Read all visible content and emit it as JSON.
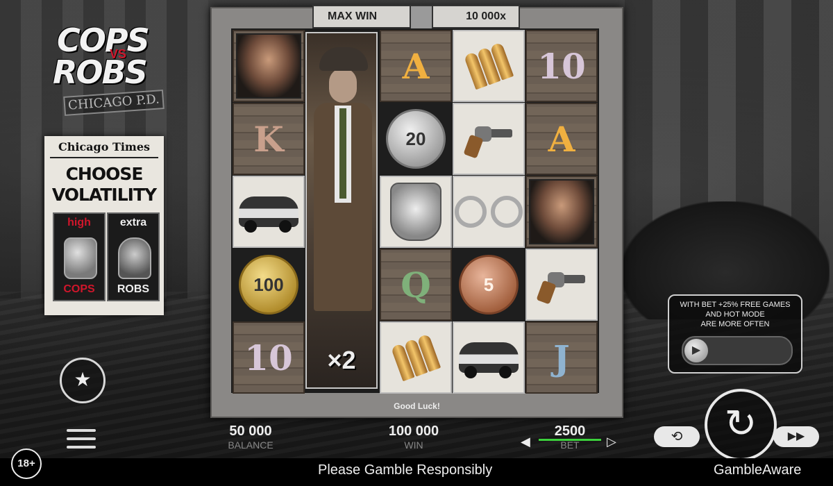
{
  "logo": {
    "cops": "COPS",
    "vs": "VS",
    "robs": "ROBS",
    "subtitle": "CHICAGO P.D."
  },
  "newspaper": {
    "title": "Chicago Times",
    "headline_line1": "CHOOSE",
    "headline_line2": "VOLATILITY",
    "options": [
      {
        "top": "high",
        "bottom": "COPS",
        "color": "#d0162b",
        "icon": "police-badge-icon"
      },
      {
        "top": "extra",
        "bottom": "ROBS",
        "color": "#f0f0f0",
        "icon": "ring-icon"
      }
    ]
  },
  "maxwin": {
    "label": "MAX WIN",
    "value": "10 000x",
    "icon": "safe-icon"
  },
  "reels": {
    "columns": [
      [
        "portrait-robber",
        "K",
        "police-car",
        "coin-100",
        "10"
      ],
      [
        "detective-wild",
        "",
        "",
        "",
        ""
      ],
      [
        "A",
        "coin-20",
        "police-badge",
        "Q",
        "bullets"
      ],
      [
        "bullets",
        "revolver",
        "handcuffs",
        "coin-5",
        "police-car"
      ],
      [
        "10",
        "A",
        "portrait-robber",
        "revolver",
        "J"
      ]
    ],
    "letters": {
      "K": "K",
      "A": "A",
      "Q": "Q",
      "J": "J",
      "ten": "10"
    },
    "coins": {
      "c20": "20",
      "c100": "100",
      "c5": "5"
    },
    "multiplier": "×2"
  },
  "status": {
    "good_luck": "Good Luck!"
  },
  "bet_boost": {
    "text_line1": "WITH BET +25% FREE GAMES",
    "text_line2": "AND HOT MODE",
    "text_line3": "ARE MORE OFTEN",
    "knob_glyph": "▶"
  },
  "stats": {
    "balance_value": "50 000",
    "balance_label": "BALANCE",
    "win_value": "100 000",
    "win_label": "WIN",
    "bet_value": "2500",
    "bet_label": "BET"
  },
  "controls": {
    "bet_down": "◀",
    "bet_up": "▷",
    "autoplay_glyph": "⟲",
    "turbo_glyph": "▶▶",
    "spin_glyph": "↻",
    "star_glyph": "★"
  },
  "footer": {
    "age": "18+",
    "responsible": "Please Gamble Responsibly",
    "gambleaware": "GambleAware"
  },
  "colors": {
    "accent_green": "#3cd13c",
    "brand_red": "#d0162b"
  }
}
